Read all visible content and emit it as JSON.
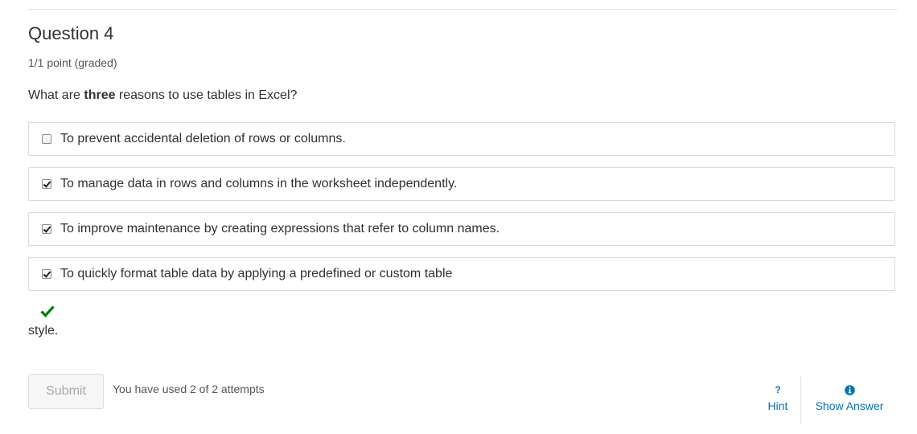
{
  "question": {
    "title": "Question 4",
    "points": "1/1 point (graded)",
    "prompt_before": "What are ",
    "prompt_bold": "three",
    "prompt_after": " reasons to use tables in Excel?"
  },
  "options": [
    {
      "label": "To prevent accidental deletion of rows or columns.",
      "checked": false
    },
    {
      "label": "To manage data in rows and columns in the worksheet independently.",
      "checked": true
    },
    {
      "label": "To improve maintenance by creating expressions that refer to column names.",
      "checked": true
    },
    {
      "label": "To quickly format table data by applying a predefined or custom table",
      "checked": true
    }
  ],
  "status": {
    "icon": "checkmark-icon",
    "color": "#008100",
    "wrapped_text": "style."
  },
  "footer": {
    "submit_label": "Submit",
    "attempts_text": "You have used 2 of 2 attempts",
    "hint_label": "Hint",
    "hint_icon": "question-icon",
    "show_answer_label": "Show Answer",
    "show_answer_icon": "info-icon",
    "link_color": "#0075b4"
  }
}
